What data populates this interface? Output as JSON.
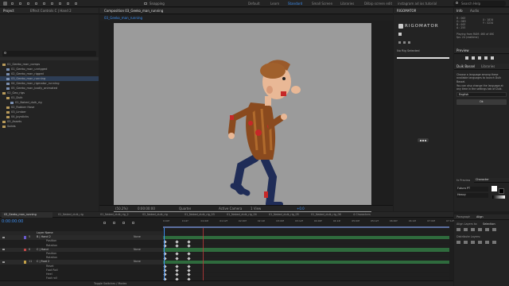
{
  "toolbar": {
    "snapping_label": "Snapping",
    "workspaces": [
      "Default",
      "Learn",
      "Standard",
      "Small Screen",
      "Libraries",
      "Dilbip screen edit",
      "instagram ad ios tutorial"
    ],
    "active_workspace": "Standard",
    "search_placeholder": "Search Help"
  },
  "project": {
    "tab_label": "Project",
    "effect_tab_label": "Effect Controls C | Hand 2",
    "search_placeholder": "",
    "tree": [
      {
        "label": "01_Geeko_man_comps",
        "indent": 0,
        "type": "folder"
      },
      {
        "label": "01_Geeko_man_unrigged",
        "indent": 1,
        "type": "comp"
      },
      {
        "label": "02_Geeko_man_rigged",
        "indent": 1,
        "type": "comp"
      },
      {
        "label": "03_Geeko_man_running",
        "indent": 1,
        "type": "comp",
        "selected": true
      },
      {
        "label": "04_Geeko_man_rigmator_running",
        "indent": 1,
        "type": "comp"
      },
      {
        "label": "05_Geeko_man_badly_animated",
        "indent": 1,
        "type": "comp"
      },
      {
        "label": "02_Geo_rigs",
        "indent": 0,
        "type": "folder"
      },
      {
        "label": "01_Duik",
        "indent": 1,
        "type": "folder"
      },
      {
        "label": "01_Naked_duik_rig",
        "indent": 2,
        "type": "comp"
      },
      {
        "label": "02_Rubber Hose",
        "indent": 1,
        "type": "folder"
      },
      {
        "label": "03_Limber",
        "indent": 1,
        "type": "folder"
      },
      {
        "label": "04_Joysticks",
        "indent": 1,
        "type": "folder"
      },
      {
        "label": "05_Assets",
        "indent": 0,
        "type": "folder"
      },
      {
        "label": "Solids",
        "indent": 0,
        "type": "folder"
      }
    ]
  },
  "composition": {
    "tab_label": "Composition 03_Geeko_man_running",
    "sub_tab": "03_Geeko_man_running",
    "zoom": "(50.2%)",
    "timecode": "0:00:00:00",
    "resolution": "Quarter",
    "camera": "Active Camera",
    "views": "1 View",
    "offset": "+0.0"
  },
  "rigomator": {
    "title": "RIGOMATOR",
    "logo_text": "RIGOMATOR",
    "status": "No Rig Selected"
  },
  "info": {
    "tabs": [
      "Info",
      "Audio"
    ],
    "r": "R : 063",
    "g": "G : 063",
    "b": "B : 063",
    "a": "A : 255",
    "x": "X : 1834",
    "y": "Y : 3234",
    "playing": "Playing from RAM: 460 of 460",
    "fps_note": "fps: 24 (realtime)"
  },
  "preview": {
    "tab_label": "Preview"
  },
  "duik": {
    "tabs": [
      "Duik Bassel",
      "Libraries"
    ],
    "message": "Choose a language among these available languages to launch Duik Bassel.",
    "message2": "You can also change the language at any time in the settings tab of Duik.",
    "language": "English",
    "ok_label": "Ok"
  },
  "character": {
    "tabs": [
      "Character",
      "Paragraph"
    ],
    "font": "Futura PT",
    "style": "Heavy",
    "fx_preview": "fx Preview",
    "align_tabs": [
      "Paragraph",
      "Align"
    ],
    "align_to": "Align Layers to:",
    "selection": "Selection",
    "distribute": "Distribute Layers:"
  },
  "timeline": {
    "active_tab": "03_Geeko_man_running",
    "tabs": [
      "01_Naked_duik_rig",
      "01_Naked_duik_rig_2",
      "02_Naked_duik_rig",
      "01_Naked_duik_rig_03",
      "01_Naked_duik_rig_04",
      "01_Naked_duik_rig_05",
      "01_Naked_duik_rig_06",
      "4 Characters"
    ],
    "timecode": "0:00:00:00",
    "ruler": [
      "0:00f",
      "0:12f",
      "01:00f",
      "01:12f",
      "02:00f",
      "02:12f",
      "03:00f",
      "03:12f",
      "04:00f",
      "04:12f",
      "05:00f",
      "05:12f",
      "06:00f",
      "06:12f",
      "07:00f",
      "07:12f"
    ],
    "columns": [
      "Layer Name",
      "Parent & Link"
    ],
    "layers": [
      {
        "num": "",
        "name": "Layer Name",
        "value": "",
        "parent": "",
        "header": true
      },
      {
        "num": "5",
        "name": "B | Hand 2",
        "value": "",
        "parent": "None",
        "color": "#6a5acd",
        "bar": "#2f6b3d"
      },
      {
        "num": "",
        "name": "Position",
        "value": "",
        "parent": "",
        "prop": true
      },
      {
        "num": "",
        "name": "Rotation",
        "value": "",
        "parent": "",
        "prop": true
      },
      {
        "num": "8",
        "name": "C | Hand",
        "value": "",
        "parent": "None",
        "color": "#c24848",
        "bar": "#2f6b3d"
      },
      {
        "num": "",
        "name": "Position",
        "value": "",
        "parent": "",
        "prop": true
      },
      {
        "num": "",
        "name": "Rotation",
        "value": "",
        "parent": "",
        "prop": true
      },
      {
        "num": "11",
        "name": "C | Foot 2",
        "value": "",
        "parent": "None",
        "color": "#c2a048",
        "bar": "#2f6b3d"
      },
      {
        "num": "",
        "name": "Reset",
        "value": "",
        "parent": "",
        "prop": true
      },
      {
        "num": "",
        "name": "Foot Roll",
        "value": "",
        "parent": "",
        "prop": true
      },
      {
        "num": "",
        "name": "Heel",
        "value": "",
        "parent": "",
        "prop": true
      },
      {
        "num": "",
        "name": "Foot roll",
        "value": "",
        "parent": "",
        "prop": true
      }
    ],
    "toggle_label": "Toggle Switches / Modes"
  }
}
